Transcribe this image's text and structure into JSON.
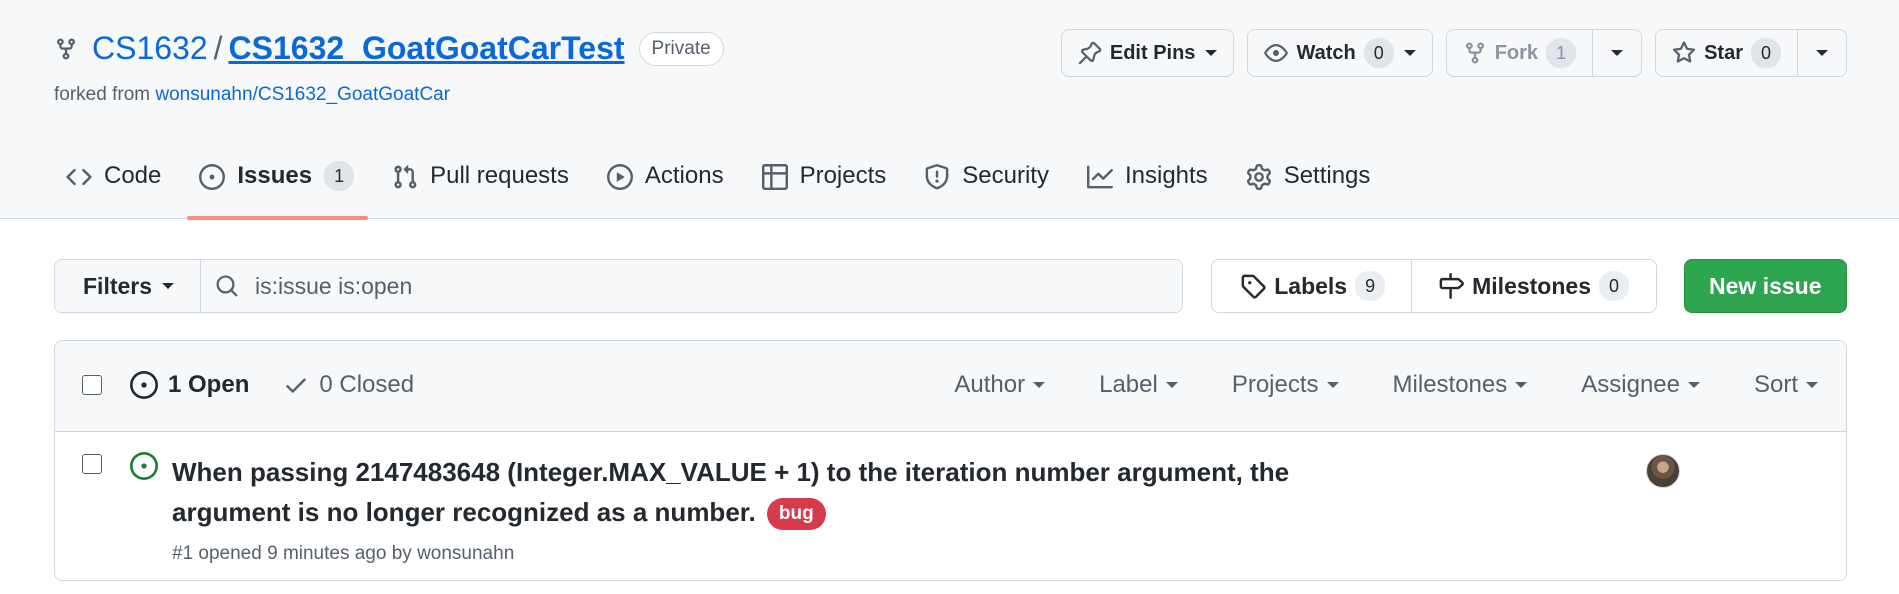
{
  "repo": {
    "owner": "CS1632",
    "separator": "/",
    "name": "CS1632_GoatGoatCarTest",
    "visibility": "Private",
    "forked_prefix": "forked from",
    "forked_source": "wonsunahn/CS1632_GoatGoatCar"
  },
  "actions": {
    "edit_pins": "Edit Pins",
    "watch": {
      "label": "Watch",
      "count": "0"
    },
    "fork": {
      "label": "Fork",
      "count": "1"
    },
    "star": {
      "label": "Star",
      "count": "0"
    }
  },
  "tabs": [
    {
      "label": "Code",
      "icon": "code-icon"
    },
    {
      "label": "Issues",
      "icon": "issue-opened-icon",
      "count": "1",
      "active": true
    },
    {
      "label": "Pull requests",
      "icon": "pull-request-icon"
    },
    {
      "label": "Actions",
      "icon": "play-icon"
    },
    {
      "label": "Projects",
      "icon": "table-icon"
    },
    {
      "label": "Security",
      "icon": "shield-icon"
    },
    {
      "label": "Insights",
      "icon": "graph-icon"
    },
    {
      "label": "Settings",
      "icon": "gear-icon"
    }
  ],
  "toolbar": {
    "filters": "Filters",
    "search_value": "is:issue is:open",
    "labels": {
      "label": "Labels",
      "count": "9"
    },
    "milestones": {
      "label": "Milestones",
      "count": "0"
    },
    "new_issue": "New issue"
  },
  "list": {
    "open": "1 Open",
    "closed": "0 Closed",
    "sorters": [
      "Author",
      "Label",
      "Projects",
      "Milestones",
      "Assignee",
      "Sort"
    ],
    "issues": [
      {
        "title": "When passing 2147483648 (Integer.MAX_VALUE + 1) to the iteration number argument, the argument is no longer recognized as a number.",
        "label": "bug",
        "meta": "#1 opened 9 minutes ago by wonsunahn"
      }
    ]
  },
  "colors": {
    "link": "#0969da",
    "active_tab_underline": "#fd8c73",
    "primary_button": "#2da44e",
    "open_issue": "#1a7f37",
    "bug_label": "#d73a4a"
  }
}
